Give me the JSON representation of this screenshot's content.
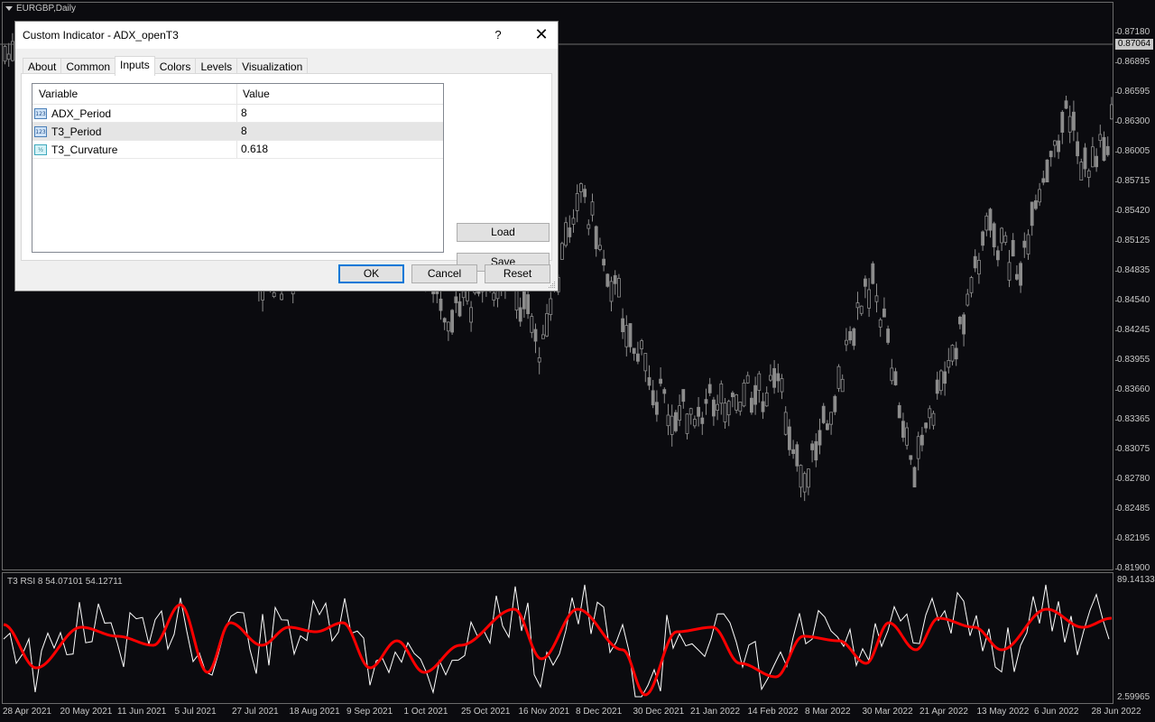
{
  "chart": {
    "symbol_label": "EURGBP,Daily",
    "indicator_label": "T3 RSI 8 54.07101 54.12711",
    "current_price": "0.87064",
    "price_ticks": [
      "0.87180",
      "0.86895",
      "0.86595",
      "0.86300",
      "0.86005",
      "0.85715",
      "0.85420",
      "0.85125",
      "0.84835",
      "0.84540",
      "0.84245",
      "0.83955",
      "0.83660",
      "0.83365",
      "0.83075",
      "0.82780",
      "0.82485",
      "0.82195",
      "0.81900"
    ],
    "indicator_max": "89.14133",
    "indicator_min": "2.59965",
    "time_ticks": [
      "28 Apr 2021",
      "20 May 2021",
      "11 Jun 2021",
      "5 Jul 2021",
      "27 Jul 2021",
      "18 Aug 2021",
      "9 Sep 2021",
      "1 Oct 2021",
      "25 Oct 2021",
      "16 Nov 2021",
      "8 Dec 2021",
      "30 Dec 2021",
      "21 Jan 2022",
      "14 Feb 2022",
      "8 Mar 2022",
      "30 Mar 2022",
      "21 Apr 2022",
      "13 May 2022",
      "6 Jun 2022",
      "28 Jun 2022"
    ],
    "colors": {
      "background": "#0b0b0f",
      "candles": "#8c8c8c",
      "rsi_line": "#ffffff",
      "t3_line": "#ff0000"
    }
  },
  "dialog": {
    "title": "Custom Indicator - ADX_openT3",
    "help_label": "?",
    "close_label": "✕",
    "tabs": [
      {
        "label": "About",
        "active": false
      },
      {
        "label": "Common",
        "active": false
      },
      {
        "label": "Inputs",
        "active": true
      },
      {
        "label": "Colors",
        "active": false
      },
      {
        "label": "Levels",
        "active": false
      },
      {
        "label": "Visualization",
        "active": false
      }
    ],
    "grid": {
      "headers": {
        "variable": "Variable",
        "value": "Value"
      },
      "rows": [
        {
          "icon": "integer-icon",
          "icon_text": "123",
          "variable": "ADX_Period",
          "value": "8",
          "selected": false
        },
        {
          "icon": "integer-icon",
          "icon_text": "123",
          "variable": "T3_Period",
          "value": "8",
          "selected": true
        },
        {
          "icon": "double-icon",
          "icon_text": "½",
          "variable": "T3_Curvature",
          "value": "0.618",
          "selected": false
        }
      ]
    },
    "load_label": "Load",
    "save_label": "Save",
    "ok_label": "OK",
    "cancel_label": "Cancel",
    "reset_label": "Reset"
  }
}
